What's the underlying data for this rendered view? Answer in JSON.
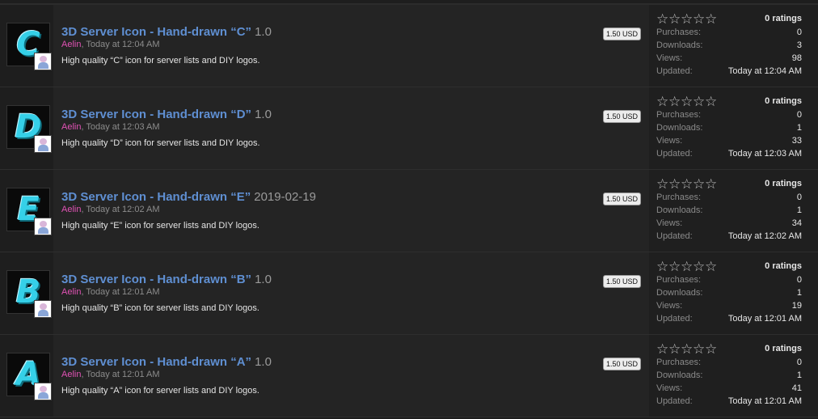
{
  "labels": {
    "purchases": "Purchases:",
    "downloads": "Downloads:",
    "views": "Views:",
    "updated": "Updated:"
  },
  "resources": [
    {
      "icon_letter": "C",
      "title": "3D Server Icon - Hand-drawn “C”",
      "version": "1.0",
      "author": "Aelin",
      "time": "Today at 12:04 AM",
      "description": "High quality “C” icon for server lists and DIY logos.",
      "price": "1.50 USD",
      "rating_stars": 0,
      "ratings": "0 ratings",
      "purchases": "0",
      "downloads": "3",
      "views": "98",
      "updated": "Today at 12:04 AM"
    },
    {
      "icon_letter": "D",
      "title": "3D Server Icon - Hand-drawn “D”",
      "version": "1.0",
      "author": "Aelin",
      "time": "Today at 12:03 AM",
      "description": "High quality “D” icon for server lists and DIY logos.",
      "price": "1.50 USD",
      "rating_stars": 0,
      "ratings": "0 ratings",
      "purchases": "0",
      "downloads": "1",
      "views": "33",
      "updated": "Today at 12:03 AM"
    },
    {
      "icon_letter": "E",
      "title": "3D Server Icon - Hand-drawn “E”",
      "version": "2019-02-19",
      "author": "Aelin",
      "time": "Today at 12:02 AM",
      "description": "High quality “E” icon for server lists and DIY logos.",
      "price": "1.50 USD",
      "rating_stars": 0,
      "ratings": "0 ratings",
      "purchases": "0",
      "downloads": "1",
      "views": "34",
      "updated": "Today at 12:02 AM"
    },
    {
      "icon_letter": "B",
      "title": "3D Server Icon - Hand-drawn “B”",
      "version": "1.0",
      "author": "Aelin",
      "time": "Today at 12:01 AM",
      "description": "High quality “B” icon for server lists and DIY logos.",
      "price": "1.50 USD",
      "rating_stars": 0,
      "ratings": "0 ratings",
      "purchases": "0",
      "downloads": "1",
      "views": "19",
      "updated": "Today at 12:01 AM"
    },
    {
      "icon_letter": "A",
      "title": "3D Server Icon - Hand-drawn “A”",
      "version": "1.0",
      "author": "Aelin",
      "time": "Today at 12:01 AM",
      "description": "High quality “A” icon for server lists and DIY logos.",
      "price": "1.50 USD",
      "rating_stars": 0,
      "ratings": "0 ratings",
      "purchases": "0",
      "downloads": "1",
      "views": "41",
      "updated": "Today at 12:01 AM"
    }
  ],
  "colors": {
    "title": "#5f8fd2",
    "author": "#e052b4",
    "icon_fill": "#35d0e8",
    "background": "#1e1e1e"
  },
  "icons": {
    "rating": "star-outline-icon",
    "avatar": "user-avatar-icon"
  }
}
